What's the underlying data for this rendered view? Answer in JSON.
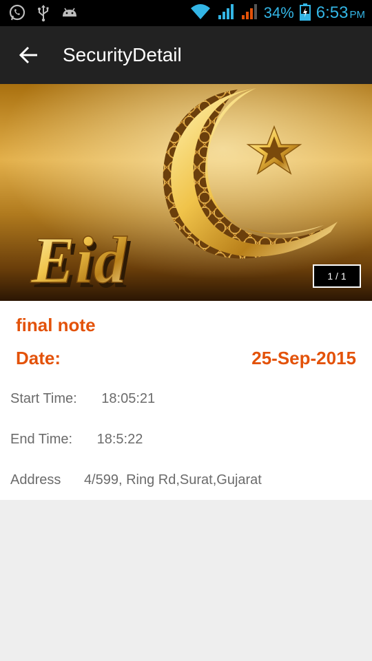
{
  "status_bar": {
    "battery": "34%",
    "time": "6:53",
    "ampm": "PM",
    "icons_left": [
      "whatsapp-icon",
      "usb-icon",
      "android-icon"
    ],
    "icons_right": [
      "wifi-icon",
      "signal-icon",
      "signal-icon-2",
      "battery-charging-icon"
    ]
  },
  "app_bar": {
    "title": "SecurityDetail"
  },
  "banner": {
    "image_text": "Eid",
    "counter": "1 / 1"
  },
  "details": {
    "note_title": "final note",
    "date_label": "Date:",
    "date_value": "25-Sep-2015",
    "start_time_label": "Start Time:",
    "start_time_value": "18:05:21",
    "end_time_label": "End Time:",
    "end_time_value": "18:5:22",
    "address_label": "Address",
    "address_value": "4/599, Ring Rd,Surat,Gujarat"
  },
  "colors": {
    "accent": "#e35209",
    "status_blue": "#33b5e5",
    "app_bar": "#222222",
    "background": "#eeeeee"
  }
}
